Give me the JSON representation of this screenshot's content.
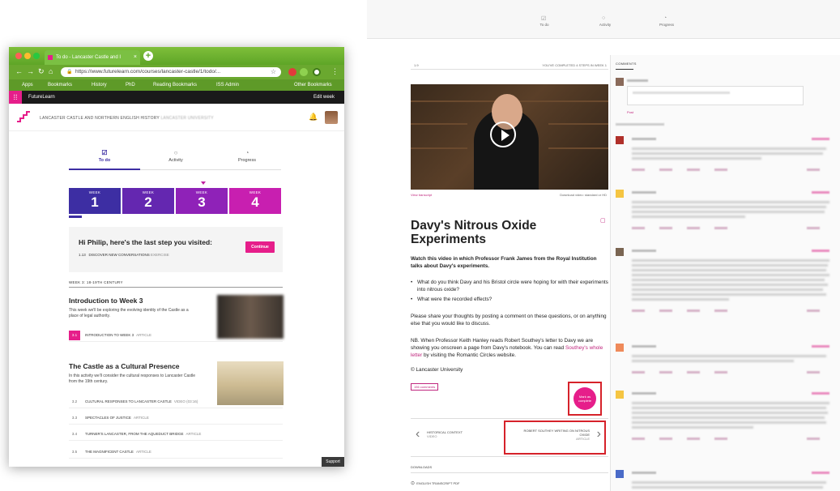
{
  "browser": {
    "tab_title": "To do - Lancaster Castle and I",
    "tab_close": "×",
    "new_tab": "+",
    "url": "https://www.futurelearn.com/courses/lancaster-castle/1/todo/...",
    "bookmarks": [
      "Apps",
      "Bookmarks",
      "History",
      "PhD",
      "Reading Bookmarks",
      "ISS Admin",
      "Other Bookmarks"
    ],
    "colors": {
      "chrome": "#6aa82f",
      "brand": "#e61e8a"
    }
  },
  "futurelearn": {
    "brand": "FutureLearn",
    "edit_week": "Edit week",
    "course_title": "LANCASTER CASTLE AND NORTHERN ENGLISH HISTORY",
    "course_org": "LANCASTER UNIVERSITY",
    "tabs": [
      {
        "label": "To do",
        "icon": "todo-icon"
      },
      {
        "label": "Activity",
        "icon": "activity-icon"
      },
      {
        "label": "Progress",
        "icon": "progress-icon"
      }
    ],
    "weeks": [
      {
        "label": "WEEK",
        "number": "1",
        "color": "#3d2ea3"
      },
      {
        "label": "WEEK",
        "number": "2",
        "color": "#6427b0"
      },
      {
        "label": "WEEK",
        "number": "3",
        "color": "#8f22b8"
      },
      {
        "label": "WEEK",
        "number": "4",
        "color": "#c81fb0"
      }
    ],
    "last_step": {
      "greeting": "Hi Philip, here's the last step you visited:",
      "step_number": "1.13",
      "step_title": "DISCOVER NEW CONVERSATIONS",
      "step_kind": "EXERCISE",
      "continue_label": "Continue"
    },
    "section_heading": "WEEK 3: 18-19TH CENTURY",
    "activities": [
      {
        "title": "Introduction to Week 3",
        "description": "This week we'll be exploring the evolving identity of the Castle as a place of legal authority.",
        "steps": [
          {
            "num": "3.1",
            "title": "INTRODUCTION TO WEEK 3",
            "kind": "ARTICLE"
          }
        ]
      },
      {
        "title": "The Castle as a Cultural Presence",
        "description": "In this activity we'll consider the cultural responses to Lancaster Castle from the 19th century.",
        "steps": [
          {
            "num": "3.2",
            "title": "CULTURAL RESPONSES TO LANCASTER CASTLE",
            "kind": "VIDEO (03:16)"
          },
          {
            "num": "3.3",
            "title": "SPECTACLES OF JUSTICE",
            "kind": "ARTICLE"
          },
          {
            "num": "3.4",
            "title": "TURNER'S LANCASTER, FROM THE AQUEDUCT BRIDGE",
            "kind": "ARTICLE"
          },
          {
            "num": "3.5",
            "title": "THE MAGNIFICENT CASTLE",
            "kind": "ARTICLE"
          }
        ]
      }
    ],
    "support": "Support"
  },
  "article_page": {
    "top_tabs": [
      "To do",
      "Activity",
      "Progress"
    ],
    "step_no": "1.9",
    "completed": "YOU'VE COMPLETED 4 STEPS IN WEEK 1",
    "view_transcript": "View transcript",
    "download_video": "Download video: standard or HD",
    "title": "Davy's Nitrous Oxide Experiments",
    "intro": "Watch this video in which Professor Frank James from the Royal Institution talks about Davy's experiments.",
    "bullets": [
      "What do you think Davy and his Bristol circle were hoping for with their experiments into nitrous oxide?",
      "What were the recorded effects?"
    ],
    "para1": "Please share your thoughts by posting a comment on these questions, or on anything else that you would like to discuss.",
    "para2_a": "NB. When Professor Keith Hanley reads Robert Southey's letter to Davy we are showing you onscreen a page from Davy's notebook. You can read ",
    "para2_link": "Southey's whole letter",
    "para2_b": " by visiting the Romantic Circles website.",
    "copyright": "© Lancaster University",
    "comments_count": "156 comments",
    "mark_complete": "Mark as complete",
    "prev_title": "HISTORICAL CONTEXT",
    "prev_kind": "VIDEO",
    "next_title": "ROBERT SOUTHEY WRITING ON NITROUS OXIDE",
    "next_kind": "ARTICLE",
    "downloads": "DOWNLOADS",
    "transcript_pdf": "ENGLISH TRANSCRIPT PDF",
    "comments_heading": "COMMENTS",
    "post_label": "Post"
  }
}
